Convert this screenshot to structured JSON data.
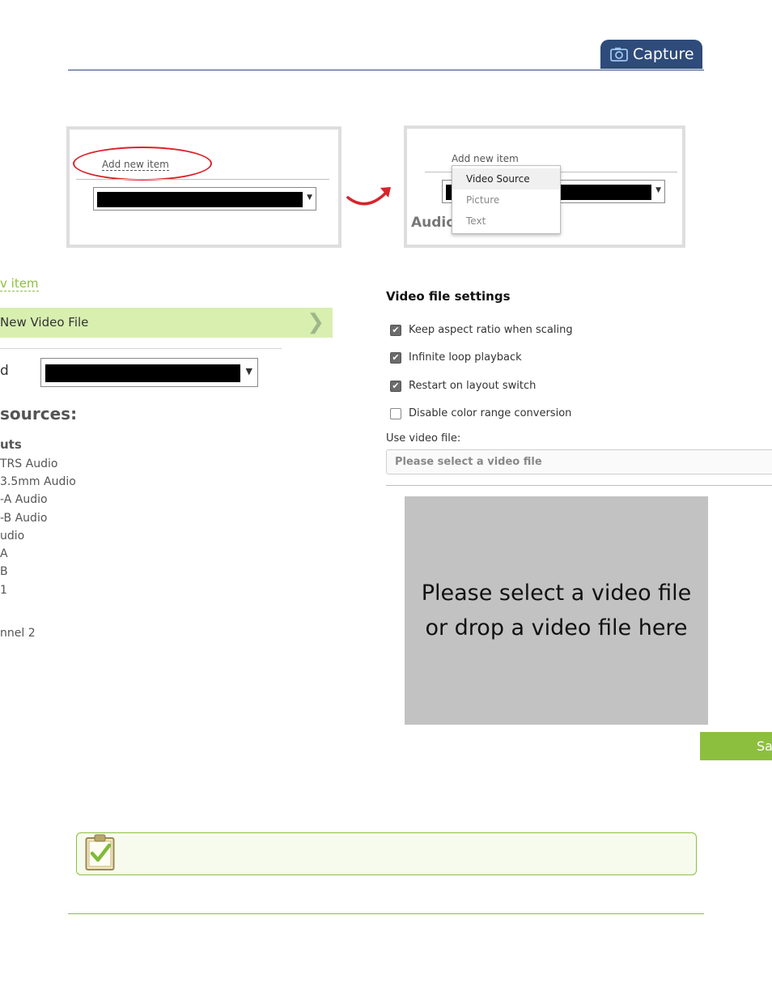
{
  "header": {
    "tab_label": "Capture"
  },
  "example_left": {
    "add_link": "Add new item"
  },
  "example_right": {
    "add_link": "Add new item",
    "menu": [
      "Video Source",
      "Picture",
      "Text"
    ],
    "partial_label": "Audio"
  },
  "left_panel": {
    "add_link_fragment": "v item",
    "new_item_label": "New Video File",
    "field_label_fragment": "d",
    "sources_heading": "sources:",
    "outputs_heading": "uts",
    "source_items": [
      "TRS Audio",
      "3.5mm Audio",
      "-A Audio",
      "-B Audio",
      "udio",
      "A",
      "B",
      "1",
      "nnel 2"
    ]
  },
  "settings": {
    "title": "Video file settings",
    "options": [
      {
        "label": "Keep aspect ratio when scaling",
        "checked": true
      },
      {
        "label": "Infinite loop playback",
        "checked": true
      },
      {
        "label": "Restart on layout switch",
        "checked": true
      },
      {
        "label": "Disable color range conversion",
        "checked": false
      }
    ],
    "use_file_label": "Use video file:",
    "file_placeholder": "Please select a video file",
    "drop_line1": "Please select a video file",
    "drop_line2": "or drop a video file here",
    "save_label": "Sa"
  },
  "colors": {
    "accent_green": "#8dbf3f",
    "header_blue": "#2e4b7a",
    "highlight_red": "#d9232a"
  }
}
